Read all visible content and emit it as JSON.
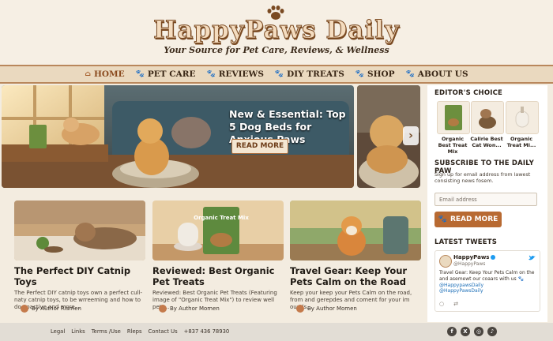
{
  "header": {
    "logo_text": "HappyPaws Daily",
    "tagline": "Your Source for Pet Care, Reviews, & Wellness"
  },
  "nav": {
    "items": [
      {
        "label": "HOME",
        "icon": "home-icon"
      },
      {
        "label": "PET CARE",
        "icon": "paw-icon"
      },
      {
        "label": "REVIEWS",
        "icon": "paw-icon"
      },
      {
        "label": "DIY TREATS",
        "icon": "paw-icon"
      },
      {
        "label": "SHOP",
        "icon": "paw-icon"
      },
      {
        "label": "ABOUT US",
        "icon": "paw-icon"
      }
    ]
  },
  "hero": {
    "title": "New & Essential: Top 5 Dog Beds for Anxious Paws",
    "button": "READ MORE"
  },
  "articles": [
    {
      "title": "The Perfect DIY Catnip Toys",
      "desc": "The Perfect DIY catnip toys own a perfect cull-naty catnip toys, to be wrreeming and how to do poactive and more...",
      "author": "By Author Rismen"
    },
    {
      "title": "Reviewed: Best Organic Pet Treats",
      "desc": "Reviewed: Best Organic Pet Treats (Featuring image of \"Organic Treat Mix\") to review well pety...",
      "author": "By Author Momen",
      "img_label": "Organic Treat Mix"
    },
    {
      "title": "Travel Gear: Keep Your Pets Calm on the Road",
      "desc": "Keep your keep your Pets Calm on the road, from and gerepdes and coment for your im ounds...",
      "author": "By Author Momen"
    }
  ],
  "sidebar": {
    "editors_choice_heading": "EDITOR'S CHOICE",
    "picks": [
      {
        "label": "Organic Best Treat Mix"
      },
      {
        "label": "Callrie Best Cat Won..."
      },
      {
        "label": "Organic Treat Mi..."
      }
    ],
    "subscribe_heading": "SUBSCRIBE TO THE DAILY PAW",
    "subscribe_text": "Sign up for email address from lawest consisting news fosem.",
    "email_placeholder": "Email address",
    "button": "READ MORE",
    "tweets_heading": "LATEST TWEETS",
    "tweet": {
      "name": "HappyPaws",
      "handle": "@HappyPaws",
      "body": "Travel Gear: Keep Your Pets Calm on the and asemewt our coaars with us 🐾",
      "link1": "@HappypawsDaily",
      "link2": "@HappyPawsDaily"
    }
  },
  "footer": {
    "links": [
      "Legal",
      "Links",
      "Terms /Use",
      "Rleps",
      "Contact Us",
      "+837 436 78930"
    ],
    "social": [
      "facebook-icon",
      "x-icon",
      "instagram-icon",
      "tiktok-icon"
    ]
  },
  "colors": {
    "accent": "#b86a32",
    "nav_bg": "#ead9bf",
    "page_bg": "#f3ece0"
  }
}
